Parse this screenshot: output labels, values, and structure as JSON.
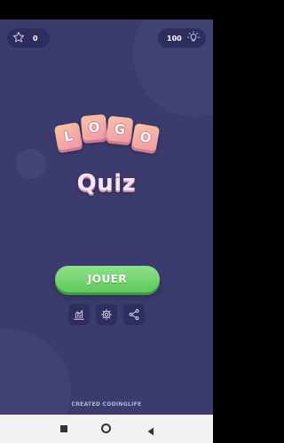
{
  "header": {
    "stars": "0",
    "hints": "100"
  },
  "logo": {
    "tiles": [
      "L",
      "O",
      "G",
      "O"
    ],
    "title": "Quiz"
  },
  "menu": {
    "play_label": "JOUER",
    "icons": [
      "stats-icon",
      "settings-icon",
      "share-icon"
    ]
  },
  "footer": {
    "credit": "CREATED CODINGLIFE"
  },
  "colors": {
    "background": "#3b3b6e",
    "pill": "#2e2e5c",
    "tile": "#f4b0a6",
    "play": "#6fd06a",
    "title": "#f6e4ee"
  }
}
